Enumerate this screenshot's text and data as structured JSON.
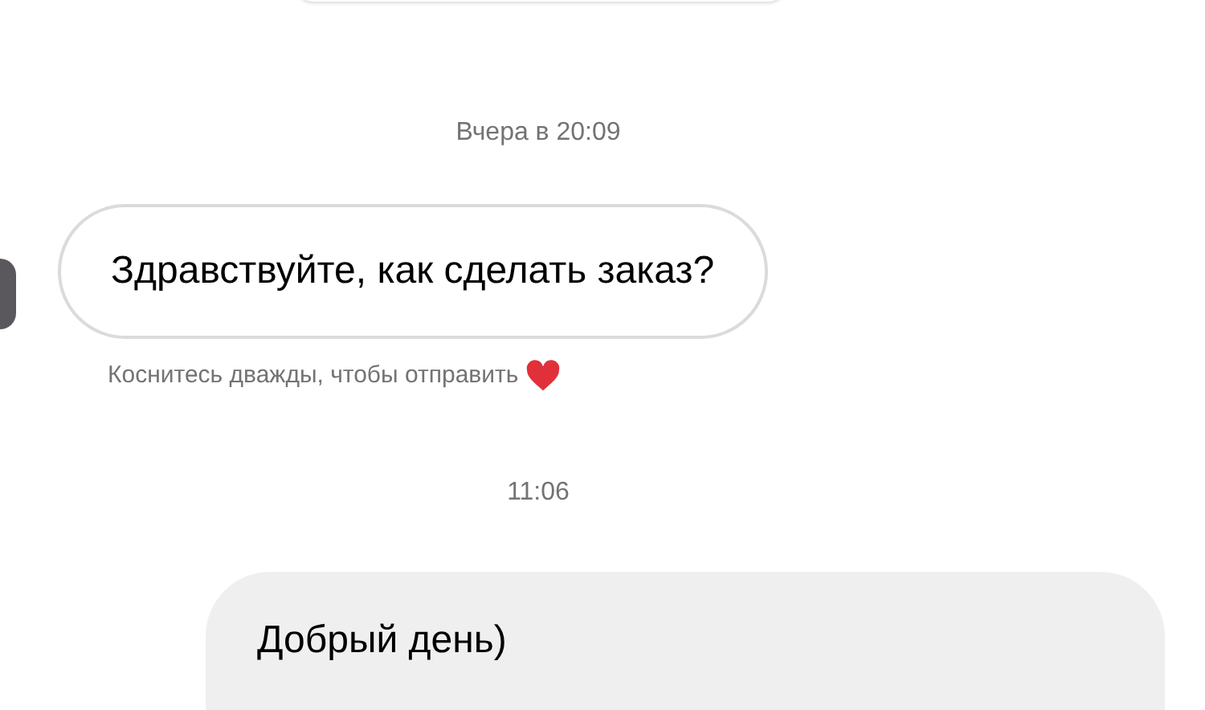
{
  "messages": [
    {
      "kind": "timestamp",
      "text": "Вчера в 20:09"
    },
    {
      "kind": "incoming",
      "text": "Здравствуйте, как сделать заказ?",
      "hint": "Коснитесь дважды, чтобы отправить"
    },
    {
      "kind": "timestamp",
      "text": "11:06"
    },
    {
      "kind": "outgoing",
      "text": "Добрый день)"
    }
  ]
}
